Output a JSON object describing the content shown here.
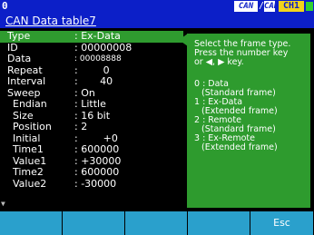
{
  "status_bar": {
    "channel_number": "0",
    "can_badge_1": "CAN",
    "separator": "/",
    "can_badge_2": "CAN",
    "ch_badge": "CH1",
    "colors": {
      "bar": "#0c1fc8",
      "ch_badge": "#f3d31a",
      "led": "#2fd12f"
    }
  },
  "title": "CAN Data table7",
  "settings": [
    {
      "label": "Type",
      "value": ": Ex-Data"
    },
    {
      "label": "ID",
      "value": ": 00000008"
    },
    {
      "label": "Data",
      "value": ": 00008888"
    },
    {
      "label": "Repeat",
      "value": ":        0"
    },
    {
      "label": "Interval",
      "value": ":       40"
    },
    {
      "label": "Sweep",
      "value": ": On"
    },
    {
      "label": "Endian",
      "value": ": Little"
    },
    {
      "label": "Size",
      "value": ": 16 bit"
    },
    {
      "label": "Position",
      "value": ": 2"
    },
    {
      "label": "Initial",
      "value": ":        +0"
    },
    {
      "label": "Time1",
      "value": ": 600000"
    },
    {
      "label": "Value1",
      "value": ": +30000"
    },
    {
      "label": "Time2",
      "value": ": 600000"
    },
    {
      "label": "Value2",
      "value": ": -30000"
    }
  ],
  "help": {
    "intro": "Select the frame type.\nPress the number key\nor ◀, ▶ key.",
    "options": [
      {
        "key": "0 : Data",
        "desc": "(Standard frame)"
      },
      {
        "key": "1 : Ex-Data",
        "desc": "(Extended frame)"
      },
      {
        "key": "2 : Remote",
        "desc": "(Standard frame)"
      },
      {
        "key": "3 : Ex-Remote",
        "desc": "(Extended frame)"
      }
    ],
    "color": "#2e9b2e"
  },
  "function_keys": [
    "",
    "",
    "",
    "",
    "Esc"
  ],
  "scroll_indicator": "▼"
}
